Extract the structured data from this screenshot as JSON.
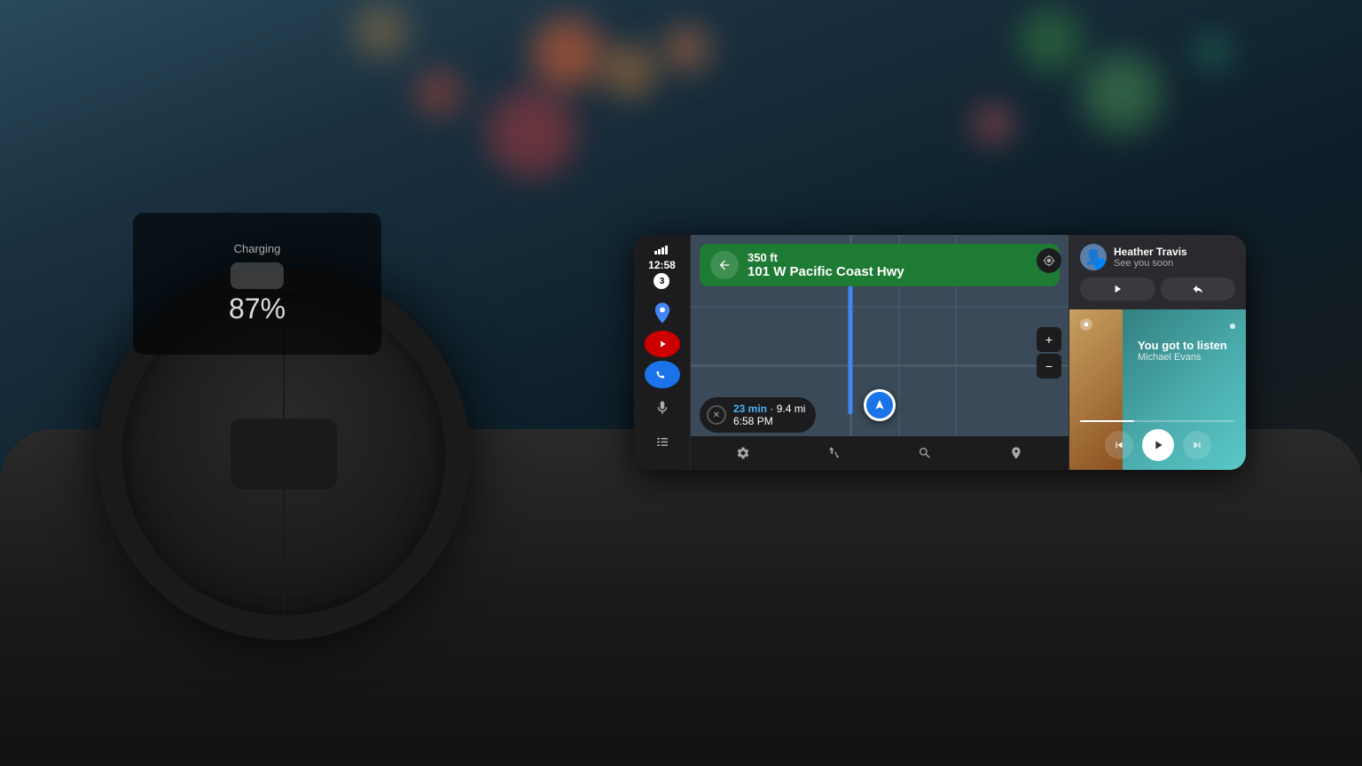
{
  "background": {
    "colors": {
      "sky": "#2a4a5a",
      "dashboard": "#1a1a1a"
    }
  },
  "cluster": {
    "label": "Charging",
    "percent": "87%"
  },
  "sidebar": {
    "time": "12:58",
    "badge": "3",
    "icons": [
      "maps",
      "youtube-music",
      "phone",
      "mic",
      "grid"
    ]
  },
  "navigation": {
    "distance": "350 ft",
    "road": "101 W Pacific Coast Hwy",
    "eta_time": "23 min",
    "eta_distance": "9.4 mi",
    "eta_clock": "6:58 PM"
  },
  "message": {
    "contact": "Heather Travis",
    "preview": "See you soon",
    "actions": {
      "play": "▶",
      "reply": "↩"
    }
  },
  "music": {
    "title": "You got to listen",
    "artist": "Michael Evans",
    "progress_pct": 35
  },
  "toolbar": {
    "settings_label": "⚙",
    "routes_label": "⑂",
    "search_label": "🔍",
    "pin_label": "📍"
  }
}
